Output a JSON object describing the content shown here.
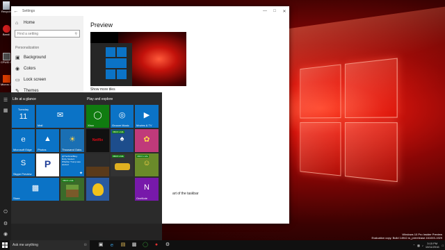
{
  "desktop": {
    "icons": [
      {
        "label": "Recycle",
        "icon": "recycle-bin-icon"
      },
      {
        "label": "Bandi",
        "icon": "app-icon"
      },
      {
        "label": "CPUID C",
        "icon": "cpuz-icon"
      },
      {
        "label": "Micros Office",
        "icon": "office-icon"
      }
    ]
  },
  "settings": {
    "title": "Settings",
    "home": "Home",
    "search_placeholder": "Find a setting",
    "section": "Personalization",
    "nav": [
      {
        "label": "Background",
        "icon": "picture-icon"
      },
      {
        "label": "Colors",
        "icon": "palette-icon"
      },
      {
        "label": "Lock screen",
        "icon": "monitor-icon"
      },
      {
        "label": "Themes",
        "icon": "brush-icon"
      }
    ],
    "heading": "Preview",
    "show_more_tiles": "Show more tiles",
    "partial_text": "art of the taskbar"
  },
  "start_menu": {
    "group1": "Life at a glance",
    "group2": "Play and explore",
    "calendar": {
      "day": "Tuesday",
      "date": "11"
    },
    "tiles": [
      {
        "name": "Mail",
        "icon": "mail-icon",
        "color": "#0b73c6"
      },
      {
        "name": "Microsoft Edge",
        "icon": "edge-icon",
        "color": "#0b73c6"
      },
      {
        "name": "Photos",
        "icon": "photos-icon",
        "color": "#0b73c6"
      },
      {
        "name": "Thousand Oaks",
        "icon": "weather-icon",
        "color": "#1a6fb3"
      },
      {
        "name": "Skype Preview",
        "icon": "skype-icon",
        "color": "#0b73c6"
      },
      {
        "name": "Pandora",
        "icon": "pandora-icon",
        "color": "#ffffff"
      },
      {
        "name": "Twitter",
        "icon": "twitter-icon",
        "color": "#0b73c6"
      },
      {
        "name": "Store",
        "icon": "store-icon",
        "color": "#0b73c6"
      },
      {
        "name": "Minecraft",
        "icon": "minecraft-icon",
        "color": "#3a6b2a"
      },
      {
        "name": "Xbox",
        "icon": "xbox-icon",
        "color": "#107c10"
      },
      {
        "name": "Groove Music",
        "icon": "groove-icon",
        "color": "#0b73c6"
      },
      {
        "name": "Movies & TV",
        "icon": "movies-icon",
        "color": "#0b73c6"
      },
      {
        "name": "Netflix",
        "icon": "netflix-icon",
        "color": "#111111"
      },
      {
        "name": "Microsoft Solitaire",
        "icon": "solitaire-icon",
        "color": "#1d4d8c"
      },
      {
        "name": "Candy Crush",
        "icon": "candy-icon",
        "color": "#c03a7a"
      },
      {
        "name": "Asphalt",
        "icon": "racing-icon",
        "color": "#333333"
      },
      {
        "name": "Farm Heroes",
        "icon": "game-icon",
        "color": "#6a8a2a"
      },
      {
        "name": "Duolingo",
        "icon": "bird-icon",
        "color": "#2a5aa0"
      },
      {
        "name": "OneNote",
        "icon": "onenote-icon",
        "color": "#7719aa"
      }
    ],
    "twitter_text": "@TheWindiBlog: Ruby Student Whether Trump was elected",
    "game_badge": "XBOX LIVE"
  },
  "taskbar": {
    "search_placeholder": "Ask me anything",
    "time": "3:15 PM",
    "date": "10/11/2016"
  },
  "watermark": {
    "line1": "Windows 10 Pro Insider Preview",
    "line2": "Evaluation copy. Build 14942.rs_prerelease.161003-1929"
  }
}
